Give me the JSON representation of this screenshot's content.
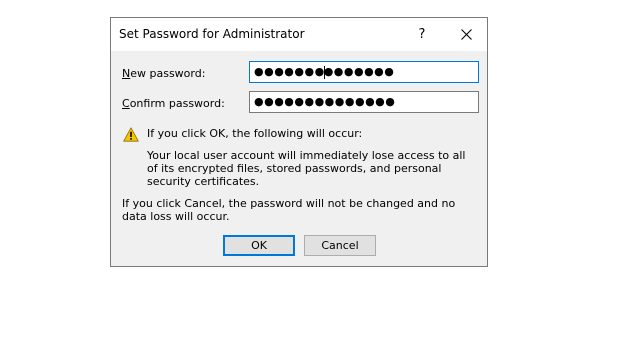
{
  "dialog": {
    "title": "Set Password for Administrator",
    "help_glyph": "?",
    "close_icon": "close-icon"
  },
  "fields": {
    "new_password": {
      "label_mnemonic": "N",
      "label_rest": "ew password:",
      "value_before_caret": "●●●●●●●",
      "value_after_caret": "●●●●●●●"
    },
    "confirm_password": {
      "label_mnemonic": "C",
      "label_rest": "onfirm password:",
      "value": "●●●●●●●●●●●●●●"
    }
  },
  "warning": {
    "icon": "warning-icon",
    "heading": "If you click OK, the following will occur:",
    "body": "Your local user account will immediately lose access to all of its encrypted files, stored passwords, and personal security certificates."
  },
  "cancel_note": "If you click Cancel, the password will not be changed and no data loss will occur.",
  "buttons": {
    "ok": "OK",
    "cancel": "Cancel"
  },
  "colors": {
    "focus_accent": "#0078d7",
    "dialog_bg": "#f0f0f0",
    "warning_yellow": "#f5c400"
  }
}
